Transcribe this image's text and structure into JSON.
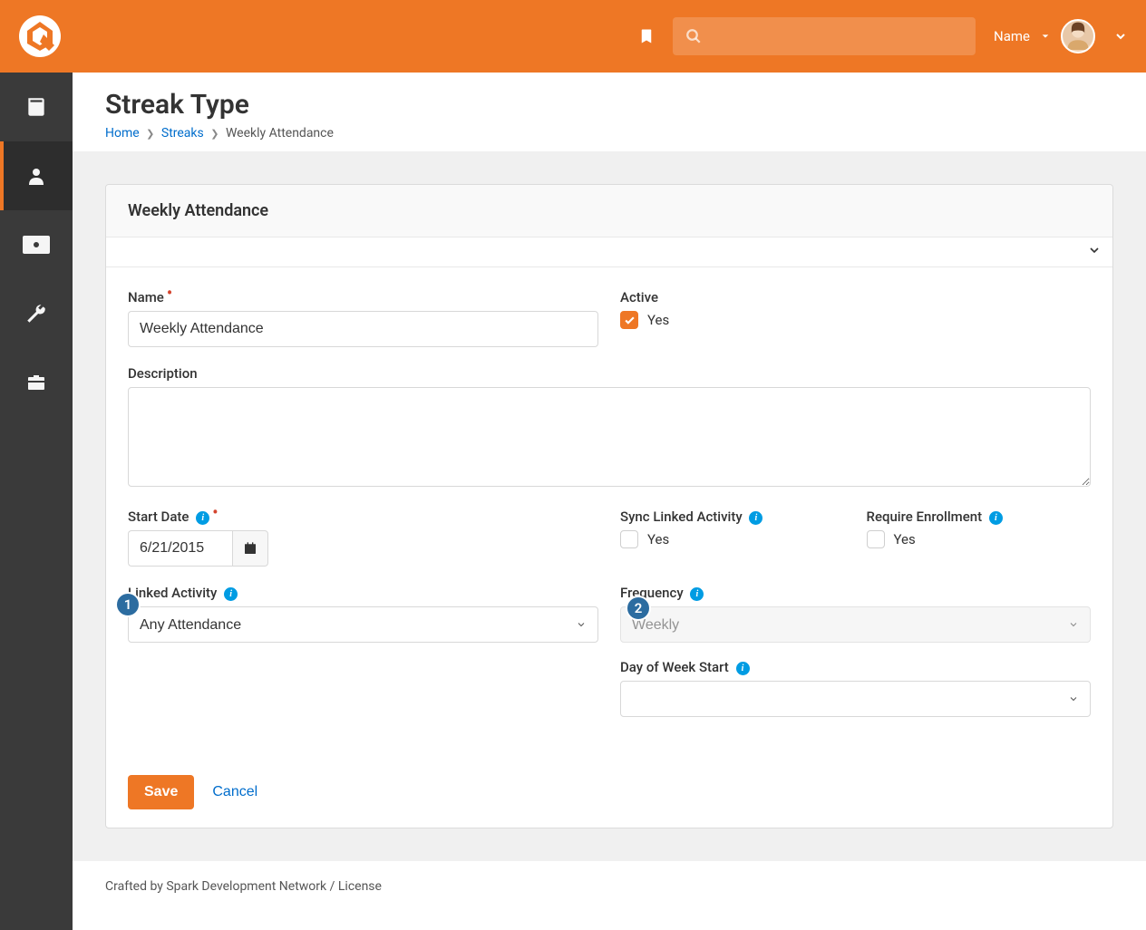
{
  "header": {
    "user_name": "Name",
    "search_placeholder": ""
  },
  "page": {
    "title": "Streak Type",
    "breadcrumb": {
      "home": "Home",
      "streaks": "Streaks",
      "current": "Weekly Attendance"
    }
  },
  "panel": {
    "title": "Weekly Attendance"
  },
  "form": {
    "name_label": "Name",
    "name_value": "Weekly Attendance",
    "active_label": "Active",
    "active_value": "Yes",
    "description_label": "Description",
    "description_value": "",
    "start_date_label": "Start Date",
    "start_date_value": "6/21/2015",
    "sync_linked_label": "Sync Linked Activity",
    "sync_linked_value": "Yes",
    "require_enrollment_label": "Require Enrollment",
    "require_enrollment_value": "Yes",
    "linked_activity_label": "Linked Activity",
    "linked_activity_value": "Any Attendance",
    "frequency_label": "Frequency",
    "frequency_value": "Weekly",
    "day_of_week_label": "Day of Week Start",
    "day_of_week_value": ""
  },
  "callouts": {
    "c1": "1",
    "c2": "2"
  },
  "buttons": {
    "save": "Save",
    "cancel": "Cancel"
  },
  "footer": {
    "text": "Crafted by Spark Development Network / License",
    "crafted_by": "Crafted by Spark Development Network",
    "license": "License"
  }
}
